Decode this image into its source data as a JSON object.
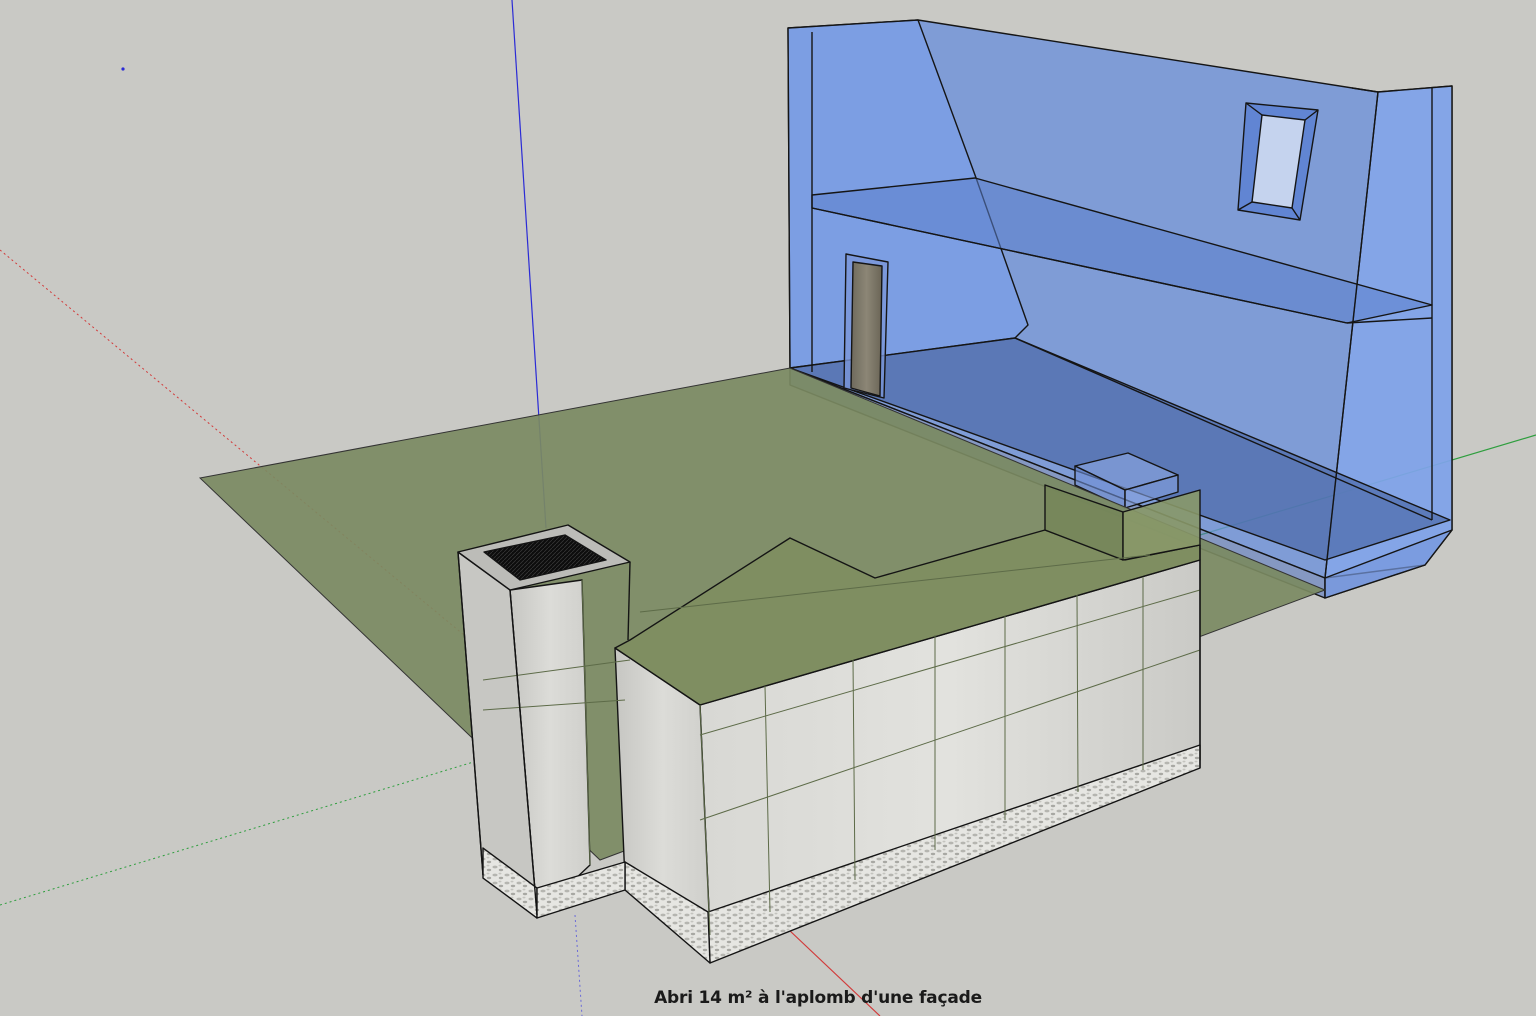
{
  "caption": "Abri 14 m² à l'aplomb d'une façade",
  "colors": {
    "background": "#c9c9c5",
    "ground_plane": "#7b8a62",
    "facade_glass": "#6f97e6",
    "concrete": "#d2d2cf",
    "gravel": "#e4e4e0",
    "axis_blue": "#2b2bd6",
    "axis_red": "#d23a3a",
    "axis_green": "#2e9e3e",
    "edge": "#151515"
  },
  "icons": {
    "vent_opening": "black-hatch-square",
    "door": "wooden-door",
    "window": "window-frame"
  }
}
